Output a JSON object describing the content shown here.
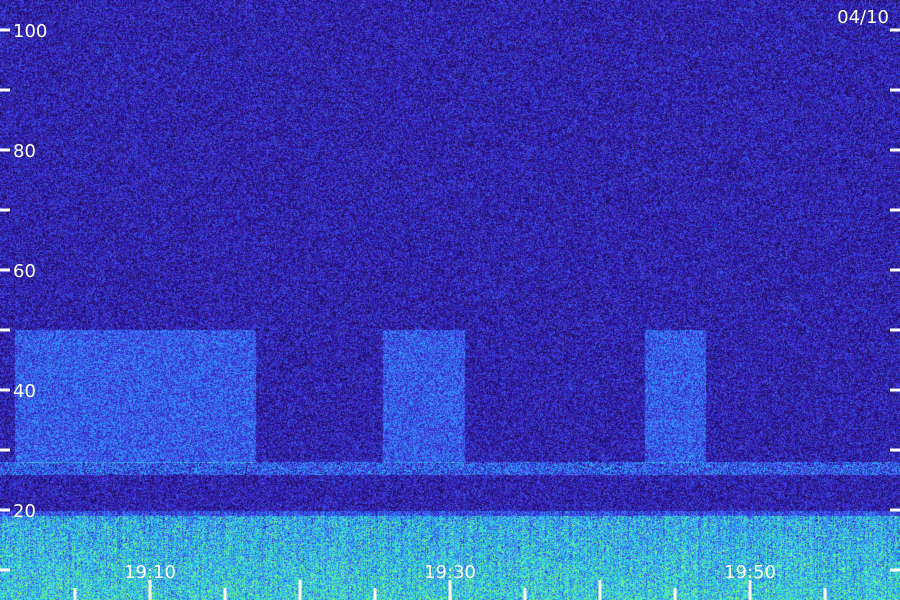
{
  "chart_data": {
    "type": "heatmap",
    "title": "",
    "xlabel": "",
    "ylabel": "",
    "date_label": "04/10",
    "x_axis": {
      "ticks": [
        "19:10",
        "19:30",
        "19:50"
      ],
      "tick_minutes": [
        10,
        30,
        50
      ],
      "range_minutes": [
        0,
        60
      ],
      "minor_tick_interval_minutes": 5
    },
    "y_axis": {
      "ticks": [
        "20",
        "40",
        "60",
        "80",
        "100"
      ],
      "tick_values": [
        20,
        40,
        60,
        80,
        100
      ],
      "range": [
        5,
        105
      ],
      "minor_tick_interval": 10
    },
    "grid": false,
    "colormap": [
      "#1a0a4a",
      "#3a20c8",
      "#3a7cff",
      "#27d2e6",
      "#7cff7a"
    ],
    "features": [
      {
        "kind": "band",
        "value_low": 26,
        "value_high": 28,
        "intensity": 0.65
      },
      {
        "kind": "band",
        "value_low": 0,
        "value_high": 19,
        "intensity": 0.9
      },
      {
        "kind": "burst",
        "minute_start": 1,
        "minute_end": 17,
        "value_low": 28,
        "value_high": 50
      },
      {
        "kind": "burst",
        "minute_start": 25.5,
        "minute_end": 31,
        "value_low": 28,
        "value_high": 50
      },
      {
        "kind": "burst",
        "minute_start": 43,
        "minute_end": 47,
        "value_low": 28,
        "value_high": 50
      }
    ]
  }
}
